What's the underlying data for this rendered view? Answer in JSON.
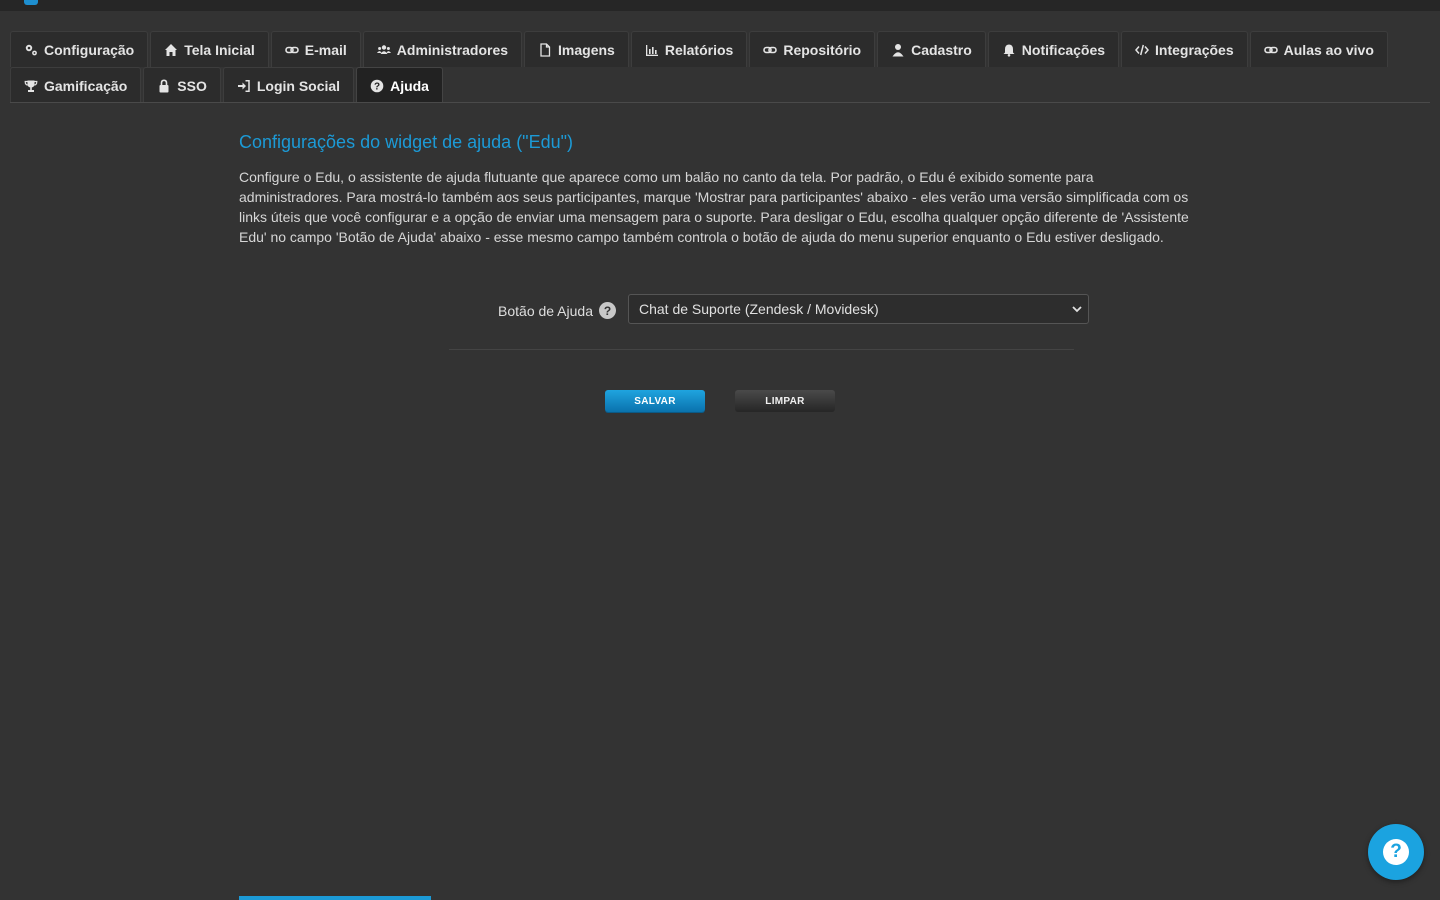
{
  "tabs": {
    "row1": [
      {
        "label": "Configuração",
        "icon": "gears-icon"
      },
      {
        "label": "Tela Inicial",
        "icon": "home-icon"
      },
      {
        "label": "E-mail",
        "icon": "link-icon"
      },
      {
        "label": "Administradores",
        "icon": "users-icon"
      },
      {
        "label": "Imagens",
        "icon": "file-icon"
      },
      {
        "label": "Relatórios",
        "icon": "bar-chart-icon"
      },
      {
        "label": "Repositório",
        "icon": "link-icon"
      },
      {
        "label": "Cadastro",
        "icon": "user-icon"
      },
      {
        "label": "Notificações",
        "icon": "bell-icon"
      },
      {
        "label": "Integrações",
        "icon": "code-icon"
      },
      {
        "label": "Aulas ao vivo",
        "icon": "link-icon"
      }
    ],
    "row2": [
      {
        "label": "Gamificação",
        "icon": "trophy-icon"
      },
      {
        "label": "SSO",
        "icon": "lock-icon"
      },
      {
        "label": "Login Social",
        "icon": "sign-in-icon"
      },
      {
        "label": "Ajuda",
        "icon": "question-circle-icon",
        "active": true
      }
    ]
  },
  "section": {
    "title": "Configurações do widget de ajuda (\"Edu\")",
    "description": "Configure o Edu, o assistente de ajuda flutuante que aparece como um balão no canto da tela. Por padrão, o Edu é exibido somente para administradores. Para mostrá-lo também aos seus participantes, marque 'Mostrar para participantes' abaixo - eles verão uma versão simplificada com os links úteis que você configurar e a opção de enviar uma mensagem para o suporte. Para desligar o Edu, escolha qualquer opção diferente de 'Assistente Edu' no campo 'Botão de Ajuda' abaixo - esse mesmo campo também controla o botão de ajuda do menu superior enquanto o Edu estiver desligado."
  },
  "form": {
    "help_button_label": "Botão de Ajuda",
    "help_button_value": "Chat de Suporte (Zendesk / Movidesk)"
  },
  "buttons": {
    "save": "SALVAR",
    "clear": "LIMPAR"
  },
  "fab": {
    "icon": "question-icon",
    "glyph": "?"
  },
  "colors": {
    "accent": "#1c9ad6",
    "background": "#333333"
  }
}
